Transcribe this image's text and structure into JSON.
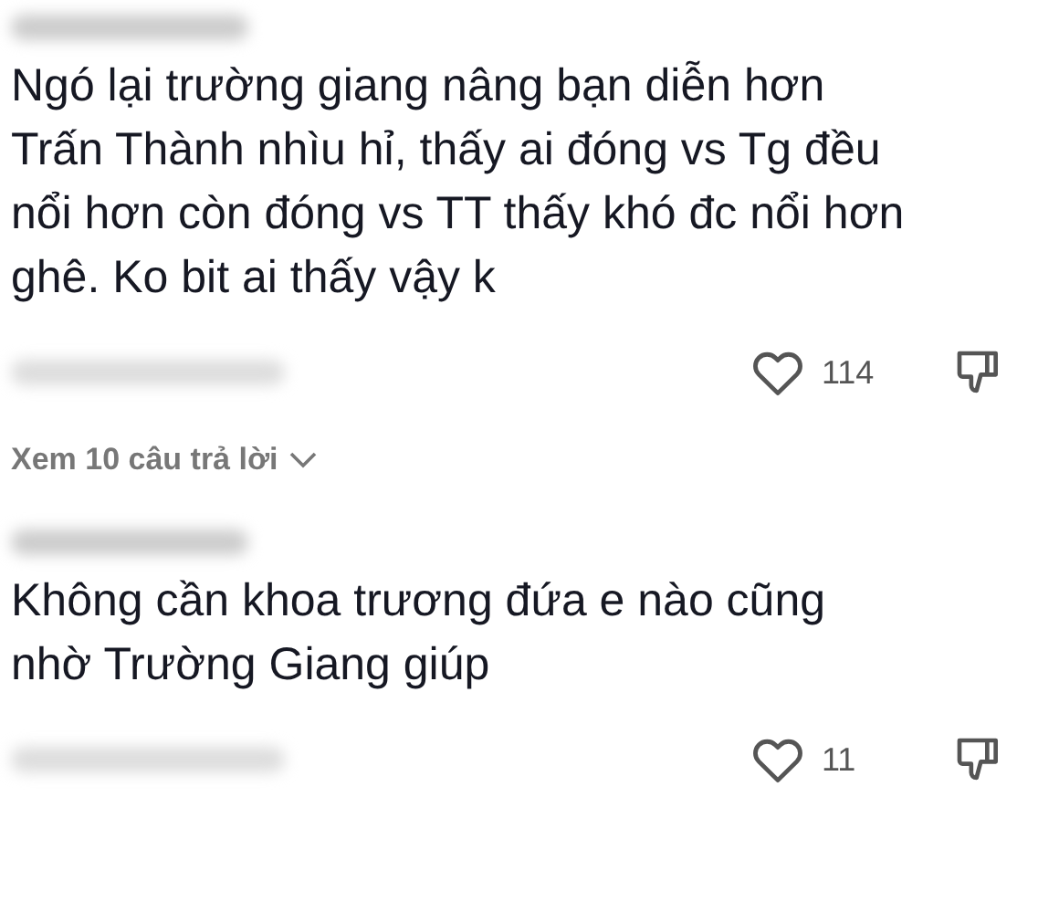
{
  "comments": [
    {
      "text": "Ngó lại trường giang nâng bạn diễn hơn\nTrấn Thành nhìu hỉ, thấy ai đóng vs Tg đều\nnổi hơn còn đóng vs TT thấy khó đc nổi hơn\nghê. Ko bit ai thấy vậy k",
      "likes": "114",
      "replies": "Xem 10 câu trả lời"
    },
    {
      "text": "Không cần khoa trương đứa e nào cũng\nnhờ Trường Giang giúp",
      "likes": "11"
    }
  ]
}
